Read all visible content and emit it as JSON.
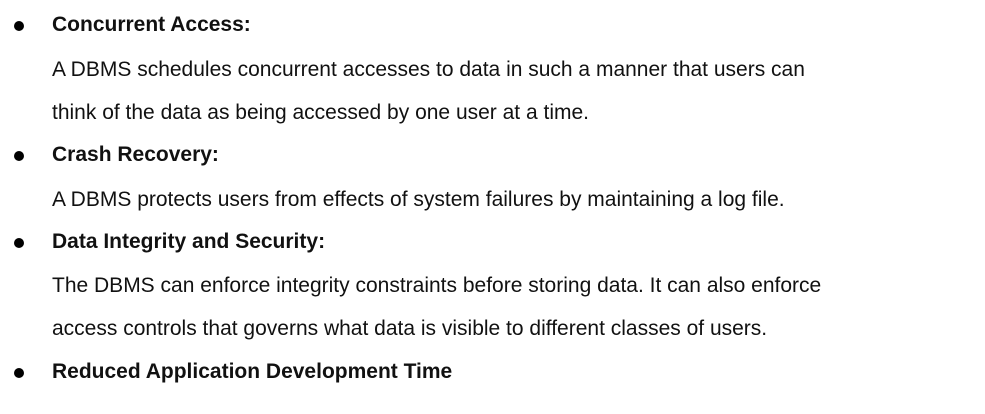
{
  "items": [
    {
      "heading": "Concurrent Access:",
      "lines": [
        "A DBMS schedules concurrent accesses to data in such a manner that users can",
        "think of the data as being accessed by one user at a time."
      ]
    },
    {
      "heading": "Crash Recovery:",
      "lines": [
        "A DBMS protects users from effects of system failures by maintaining a log file."
      ]
    },
    {
      "heading": "Data Integrity and Security:",
      "lines": [
        "The DBMS can enforce integrity constraints before storing data. It can also enforce",
        "access controls that governs what data is visible to different classes of users."
      ]
    },
    {
      "heading": "Reduced Application Development Time",
      "lines": []
    }
  ]
}
